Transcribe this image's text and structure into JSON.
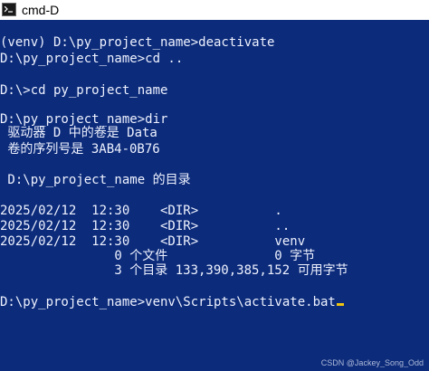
{
  "window": {
    "title": "cmd-D",
    "icon": "terminal-icon"
  },
  "console": {
    "lines": [
      "(venv) D:\\py_project_name>deactivate",
      "D:\\py_project_name>cd ..",
      "",
      "D:\\>cd py_project_name",
      "",
      "D:\\py_project_name>dir",
      " 驱动器 D 中的卷是 Data",
      " 卷的序列号是 3AB4-0B76",
      "",
      " D:\\py_project_name 的目录",
      "",
      "2025/02/12  12:30    <DIR>          .",
      "2025/02/12  12:30    <DIR>          ..",
      "2025/02/12  12:30    <DIR>          venv",
      "               0 个文件              0 字节",
      "               3 个目录 133,390,385,152 可用字节",
      "",
      "D:\\py_project_name>venv\\Scripts\\activate.bat"
    ],
    "colors": {
      "background": "#0c2b7a",
      "text": "#eef2ff",
      "cursor": "#f1c40f"
    }
  },
  "watermark": "CSDN @Jackey_Song_Odd"
}
